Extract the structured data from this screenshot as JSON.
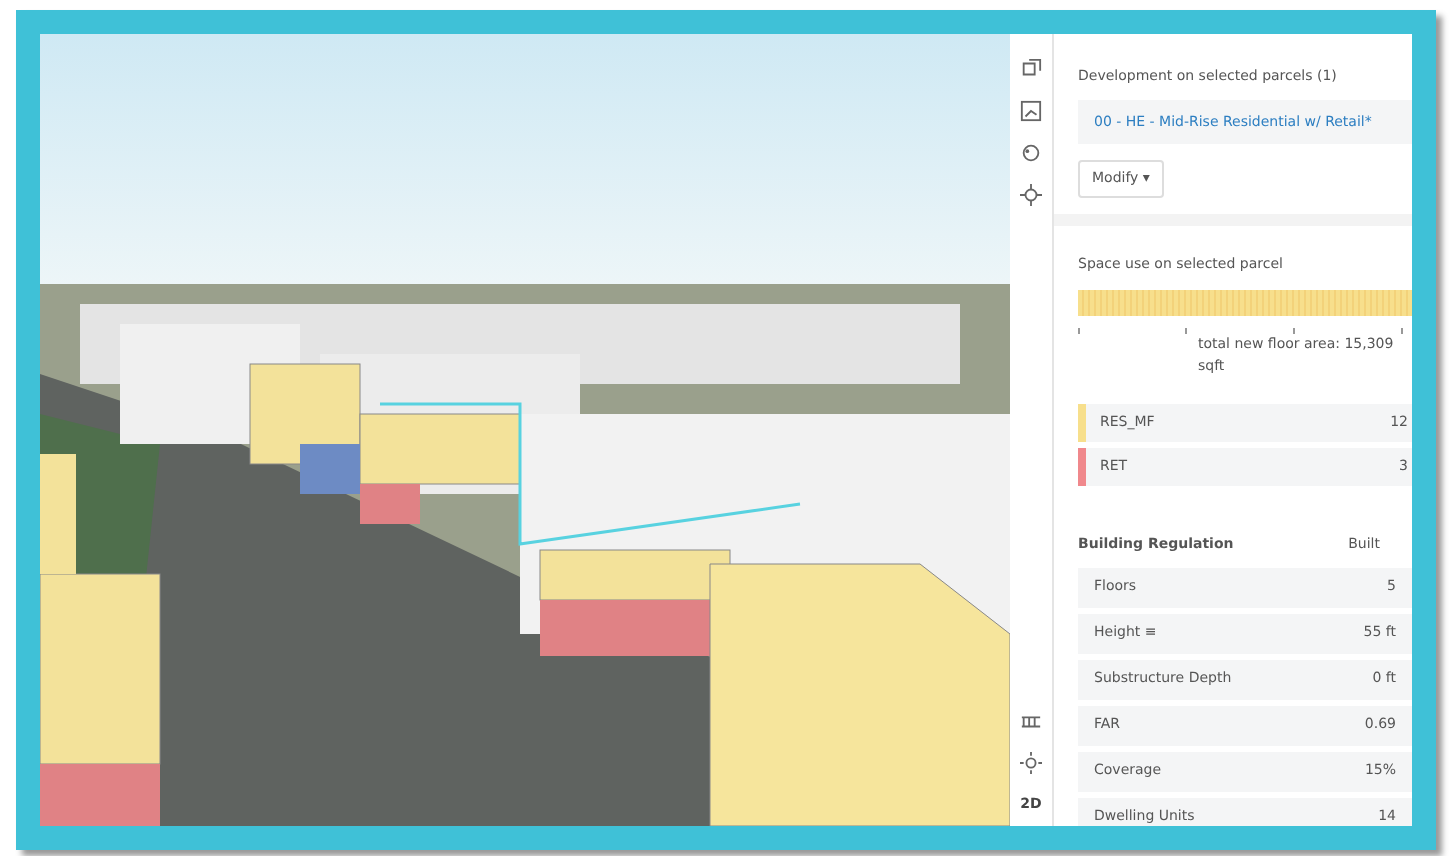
{
  "toolbar": {
    "mode_label": "2D"
  },
  "development": {
    "title": "Development on selected parcels (1)",
    "scenario": "00 - HE - Mid-Rise Residential w/ Retail*",
    "modify_button": "Modify ▾"
  },
  "space_use": {
    "title": "Space use on selected parcel",
    "total": "total new floor area: 15,309 sqft",
    "uses": [
      {
        "name": "RES_MF",
        "value": "12",
        "color": "#f7df8c"
      },
      {
        "name": "RET",
        "value": "3",
        "color": "#f0888c"
      }
    ]
  },
  "regulation": {
    "title": "Building Regulation",
    "column": "Built",
    "rows": [
      {
        "label": "Floors",
        "value": "5"
      },
      {
        "label": "Height ≡",
        "value": "55 ft"
      },
      {
        "label": "Substructure Depth",
        "value": "0 ft"
      },
      {
        "label": "FAR",
        "value": "0.69"
      },
      {
        "label": "Coverage",
        "value": "15%"
      },
      {
        "label": "Dwelling Units",
        "value": "14"
      }
    ]
  }
}
